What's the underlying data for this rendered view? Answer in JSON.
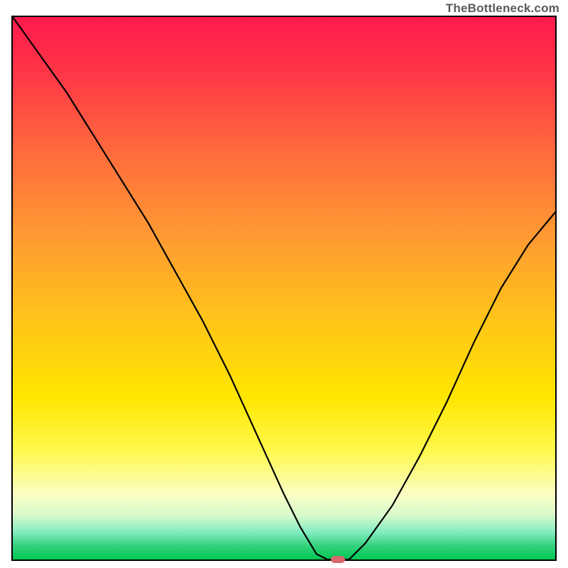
{
  "brand": "TheBottleneck.com",
  "chart_data": {
    "type": "line",
    "title": "",
    "xlabel": "",
    "ylabel": "",
    "xlim": [
      0,
      100
    ],
    "ylim": [
      0,
      100
    ],
    "series": [
      {
        "name": "bottleneck-curve",
        "x": [
          0,
          5,
          10,
          15,
          20,
          25,
          30,
          35,
          40,
          45,
          50,
          53,
          56,
          58,
          62,
          65,
          70,
          75,
          80,
          85,
          90,
          95,
          100
        ],
        "y": [
          100,
          93,
          86,
          78,
          70,
          62,
          53,
          44,
          34,
          23,
          12,
          6,
          1,
          0,
          0,
          3,
          10,
          19,
          29,
          40,
          50,
          58,
          64
        ]
      }
    ],
    "marker": {
      "x": 60,
      "y": 0,
      "color": "#d7686a"
    },
    "gradient_stops": [
      {
        "pos": 0,
        "color": "#ff1a4d"
      },
      {
        "pos": 0.1,
        "color": "#ff3547"
      },
      {
        "pos": 0.25,
        "color": "#ff6b3d"
      },
      {
        "pos": 0.4,
        "color": "#ff9933"
      },
      {
        "pos": 0.55,
        "color": "#ffc21a"
      },
      {
        "pos": 0.7,
        "color": "#ffe600"
      },
      {
        "pos": 0.8,
        "color": "#fff94d"
      },
      {
        "pos": 0.88,
        "color": "#fbfec4"
      },
      {
        "pos": 0.92,
        "color": "#d6facc"
      },
      {
        "pos": 0.95,
        "color": "#80ecc0"
      },
      {
        "pos": 0.975,
        "color": "#33d17a"
      },
      {
        "pos": 1.0,
        "color": "#00c853"
      }
    ]
  }
}
